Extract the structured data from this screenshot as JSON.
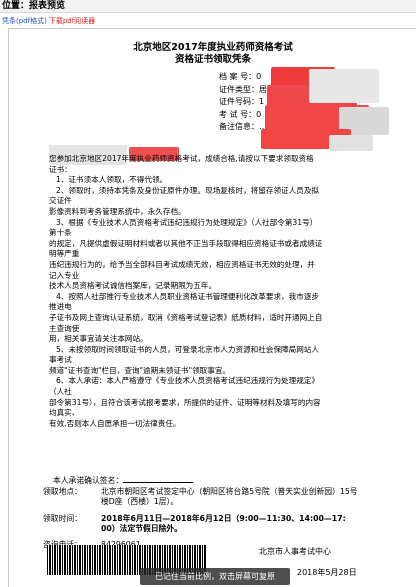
{
  "topbar": {
    "title": "位置：报表预览"
  },
  "links": {
    "print_label": "凭条(pdf格式)",
    "download_label": "下载pdf阅读器"
  },
  "doc": {
    "title_line1": "北京地区2017年度执业药师资格考试",
    "title_line2": "资格证书领取凭条",
    "info": [
      {
        "label": "档 案 号：",
        "value": "0"
      },
      {
        "label": "证件类型：",
        "value": "居"
      },
      {
        "label": "证件号码：",
        "value": "1"
      },
      {
        "label": "考 试 号：",
        "value": "0"
      },
      {
        "label": "备注信息：",
        "value": "…"
      }
    ],
    "paragraphs": [
      "您参加北京地区2017年度执业药师资格考试，成绩合格,请按以下要求领取资格",
      "证书：",
      "1、证书须本人领取，不得代领。",
      "2、领取时，须持本凭条及身份证原件办理。现场复核时，将留存领证人员及拟",
      "交证件",
      "影像资料到考务管理系统中，永久存档。",
      "3、根据《专业技术人员资格考试违纪违规行为处理规定》（人社部令第31号）",
      "第十条",
      "的规定，凡提供虚假证明材料或者以其他不正当手段取得相应资格证书或者成绩证",
      "明等严重",
      "违纪违规行为的，给予当全部科目考试成绩无效，相应资格证书无效的处理，并",
      "记入专业",
      "技术人员资格考试诚信档案库，记录期限为五年。",
      "4、按照人社部推行专业技术人员职业资格证书管理便利化改革要求，我市逐步",
      "推进电",
      "子证书及网上查询认证系统，取消《资格考试登记表》纸质材料，适时开通网上自",
      "主查询使",
      "用，相关事宜请关注本网站。",
      "5、未按领取时间领取证书的人员，可登录北京市人力资源和社会保障局网站人",
      "事考试",
      "频道\"证书查询\"栏目，查询\"逾期未领证书\"领取事宜。",
      "6、本人承诺：本人严格遵守《专业技术人员资格考试违纪违规行为处理规定》",
      "（人社",
      "部令第31号），且符合该考试报考要求，所提供的证件、证明等材料及填写的内容",
      "均真实、",
      "有效,否则本人自愿承担一切法律责任。"
    ],
    "signature_label": "本人承诺确认签名：",
    "location_label": "领取地点：",
    "location_lines": [
      "北京市朝阳区考试签定中心（朝阳区将台路5号院（普天实业创新园）15号",
      "楼D座（西楼）1层）。"
    ],
    "time_label": "领取时间：",
    "time_lines": [
      "2018年6月11日—2018年6月12日（9:00—11:30、14:00—17:",
      "00）法定节假日除外。"
    ],
    "phone_label": "咨询电话：",
    "phone_value": "84296061。",
    "issuer": "北京市人事考试中心",
    "date": "2018年5月28日"
  },
  "toast": {
    "text": "已记住当前比例，双击屏幕可复原"
  }
}
